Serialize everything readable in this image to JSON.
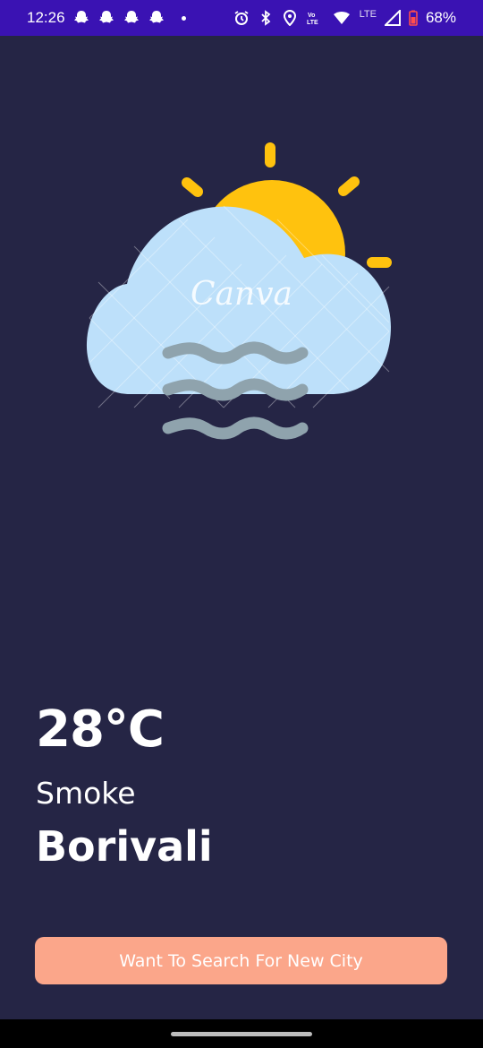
{
  "status_bar": {
    "time": "12:26",
    "battery": "68%",
    "network": "LTE",
    "volte": "Vo LTE",
    "background_color": "#3a12b3"
  },
  "weather": {
    "icon": "fog-cloud-sun-icon",
    "watermark": "Canva",
    "temperature": "28°C",
    "condition": "Smoke",
    "city": "Borivali"
  },
  "actions": {
    "search_label": "Want To Search For New City",
    "button_color": "#fba68a"
  },
  "theme": {
    "background": "#252545",
    "sun": "#ffc20e",
    "cloud": "#bde0fa",
    "fog": "#8fa3ad"
  }
}
